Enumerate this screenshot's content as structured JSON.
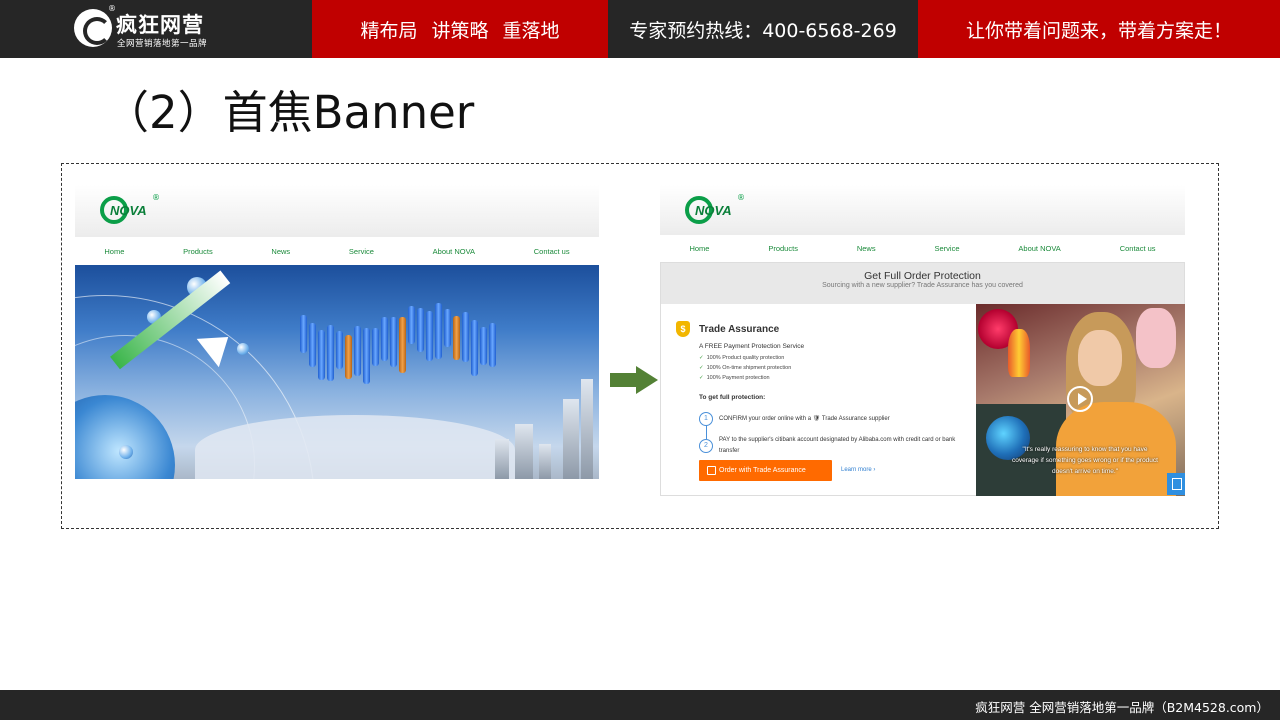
{
  "topbar": {
    "logo_name": "疯狂网营",
    "logo_reg": "®",
    "logo_slogan": "全网营销落地第一品牌",
    "slogan_red": "精布局 讲策略 重落地",
    "hotline": "专家预约热线：400-6568-269",
    "tagline": "让你带着问题来，带着方案走！",
    "colors": {
      "dark": "#262626",
      "red": "#c00000"
    }
  },
  "slide": {
    "title": "（2）首焦Banner"
  },
  "left_site": {
    "logo_text": "NOVA",
    "logo_reg": "®",
    "nav": [
      "Home",
      "Products",
      "News",
      "Service",
      "About NOVA",
      "Contact us"
    ]
  },
  "arrow_icon": "right-arrow-icon",
  "right_site": {
    "logo_text": "NOVA",
    "logo_reg": "®",
    "nav": [
      "Home",
      "Products",
      "News",
      "Service",
      "About NOVA",
      "Contact us"
    ],
    "panel": {
      "heading": "Get Full Order Protection",
      "subheading": "Sourcing with a new supplier? Trade Assurance has you covered",
      "shield_symbol": "$",
      "title": "Trade Assurance",
      "subtitle": "A FREE Payment Protection Service",
      "checks": [
        "100% Product quality protection",
        "100% On-time shipment protection",
        "100% Payment protection"
      ],
      "check_mark": "✓",
      "get_label": "To get full protection:",
      "steps": [
        {
          "num": "1",
          "text": "CONFIRM your order online with a 🛡 Trade Assurance supplier"
        },
        {
          "num": "2",
          "text": "PAY to the supplier's citibank account designated by Alibaba.com with credit card or bank transfer"
        }
      ],
      "button_label": "Order with Trade Assurance",
      "learn_more": "Learn more ›",
      "video_quote": "\"It's really reassuring to know that you have coverage if something goes wrong or if the product doesn't arrive on time.\""
    }
  },
  "footer": {
    "text": "疯狂网营  全网营销落地第一品牌（B2M4528.com）"
  }
}
